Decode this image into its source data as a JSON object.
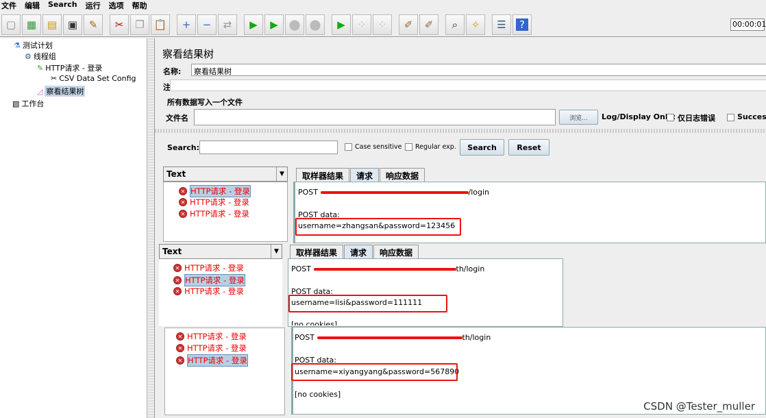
{
  "menu": [
    "文件",
    "编辑",
    "Search",
    "运行",
    "选项",
    "帮助"
  ],
  "toolbar": {
    "icons": [
      "new-icon",
      "templates-icon",
      "open-icon",
      "save-icon",
      "save-as-icon",
      "cut-icon",
      "copy-icon",
      "paste-icon",
      "expand-icon",
      "collapse-icon",
      "toggle-icon",
      "start-icon",
      "start-no-pause-icon",
      "stop-icon",
      "shutdown-icon",
      "remote-start-icon",
      "remote-stop-icon",
      "remote-shutdown-icon",
      "clear-icon",
      "clear-all-icon",
      "search-icon",
      "reset-search-icon",
      "function-helper-icon",
      "help-icon"
    ],
    "timer": "00:00:01"
  },
  "tree": {
    "items": [
      "测试计划",
      "线程组",
      "HTTP请求 - 登录",
      "CSV Data Set Config",
      "察看结果树",
      "工作台"
    ]
  },
  "panel": {
    "title": "察看结果树",
    "name_label": "名称:",
    "name_value": "察看结果树",
    "comment_label": "注释:",
    "group_title": "所有数据写入一个文件",
    "file_label": "文件名",
    "file_value": "",
    "browse": "浏览...",
    "log_display": "Log/Display Only:",
    "errors_only": "仅日志错误",
    "successes": "Successes"
  },
  "search": {
    "label": "Search:",
    "value": "",
    "case_sensitive": "Case sensitive",
    "regex": "Regular exp.",
    "search_btn": "Search",
    "reset_btn": "Reset"
  },
  "results": [
    {
      "combo": "Text",
      "items": [
        "HTTP请求 - 登录",
        "HTTP请求 - 登录",
        "HTTP请求 - 登录"
      ],
      "selected": 0,
      "tabs": [
        "取样器结果",
        "请求",
        "响应数据"
      ],
      "method": "POST",
      "url_tail": "/login",
      "post_label": "POST data:",
      "post_data": "username=zhangsan&password=123456"
    },
    {
      "combo": "Text",
      "items": [
        "HTTP请求 - 登录",
        "HTTP请求 - 登录",
        "HTTP请求 - 登录"
      ],
      "selected": 1,
      "tabs": [
        "取样器结果",
        "请求",
        "响应数据"
      ],
      "method": "POST",
      "url_tail": "th/login",
      "post_label": "POST data:",
      "post_data": "username=lisi&password=111111",
      "cookies": "[no cookies]"
    },
    {
      "items": [
        "HTTP请求 - 登录",
        "HTTP请求 - 登录",
        "HTTP请求 - 登录"
      ],
      "selected": 2,
      "method": "POST",
      "url_tail": "th/login",
      "post_label": "POST data:",
      "post_data": "username=xiyangyang&password=567890",
      "cookies": "[no cookies]"
    }
  ],
  "watermark": "CSDN @Tester_muller",
  "colors": {
    "error_text": "#ee0000",
    "highlight_box": "#ee1111",
    "selection": "#b8cfe5"
  }
}
